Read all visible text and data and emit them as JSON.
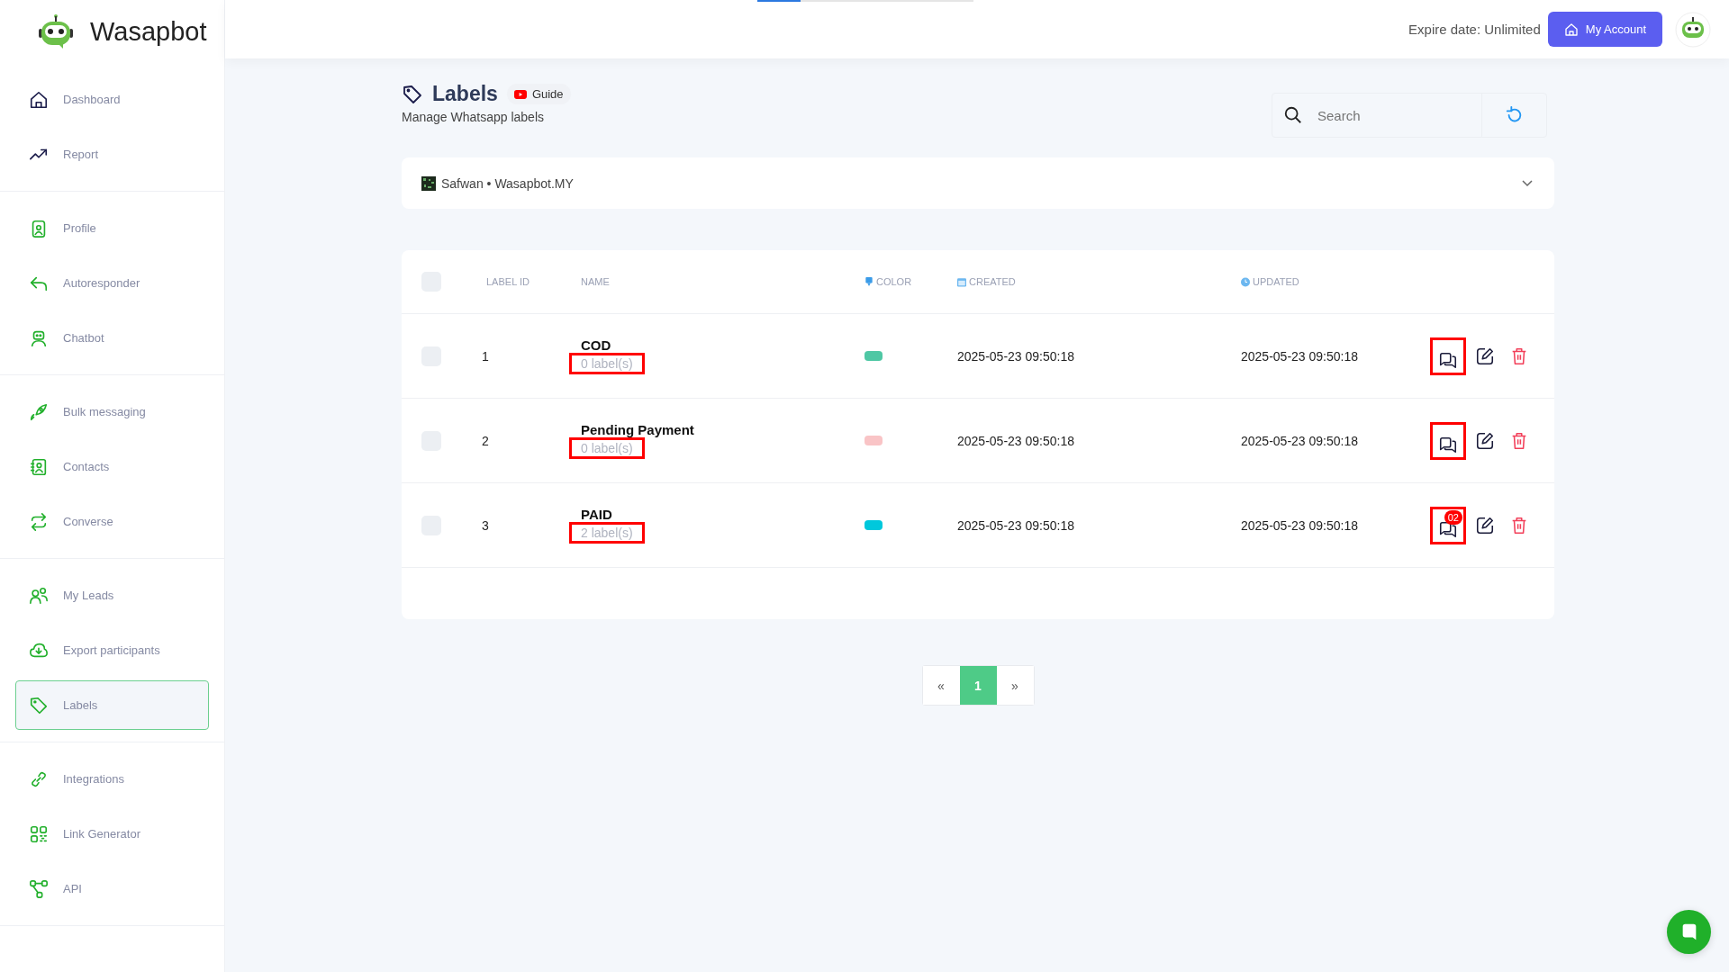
{
  "brand": "Wasapbot",
  "sidebar": {
    "groups": [
      {
        "items": [
          {
            "label": "Dashboard",
            "selected": false
          },
          {
            "label": "Report",
            "selected": false
          }
        ]
      },
      {
        "items": [
          {
            "label": "Profile",
            "selected": false
          },
          {
            "label": "Autoresponder",
            "selected": false
          },
          {
            "label": "Chatbot",
            "selected": false
          }
        ]
      },
      {
        "items": [
          {
            "label": "Bulk messaging",
            "selected": false
          },
          {
            "label": "Contacts",
            "selected": false
          },
          {
            "label": "Converse",
            "selected": false
          }
        ]
      },
      {
        "items": [
          {
            "label": "My Leads",
            "selected": false
          },
          {
            "label": "Export participants",
            "selected": false
          },
          {
            "label": "Labels",
            "selected": true
          }
        ]
      },
      {
        "items": [
          {
            "label": "Integrations",
            "selected": false
          },
          {
            "label": "Link Generator",
            "selected": false
          },
          {
            "label": "API",
            "selected": false
          }
        ]
      }
    ]
  },
  "loading_bar": {
    "level": 0.2
  },
  "header": {
    "expire": "Expire date: Unlimited",
    "account_button": "My Account"
  },
  "page": {
    "title": "Labels",
    "guide": "Guide",
    "subtitle": "Manage Whatsapp labels"
  },
  "search": {
    "placeholder": "Search"
  },
  "device_select": {
    "value": "Safwan • Wasapbot.MY"
  },
  "table": {
    "select_all_checked": false,
    "columns": [
      "LABEL ID",
      "NAME",
      "COLOR",
      "CREATED",
      "UPDATED"
    ],
    "rows": [
      {
        "checked": false,
        "id": "1",
        "name": "COD",
        "count": "0 label(s)",
        "color": "#4fc7a4",
        "created": "2025-05-23 09:50:18",
        "updated": "2025-05-23 09:50:18",
        "highlighted": true
      },
      {
        "checked": false,
        "id": "2",
        "name": "Pending Payment",
        "count": "0 label(s)",
        "color": "#f9c4c6",
        "created": "2025-05-23 09:50:18",
        "updated": "2025-05-23 09:50:18",
        "highlighted": true
      },
      {
        "checked": false,
        "id": "3",
        "name": "PAID",
        "count": "2 label(s)",
        "color": "#00c8dc",
        "created": "2025-05-23 09:50:18",
        "updated": "2025-05-23 09:50:18",
        "highlighted": true,
        "badge": "02"
      }
    ]
  },
  "pagination": {
    "prev": "«",
    "pages": [
      {
        "label": "1",
        "selected": true
      }
    ],
    "next": "»"
  }
}
